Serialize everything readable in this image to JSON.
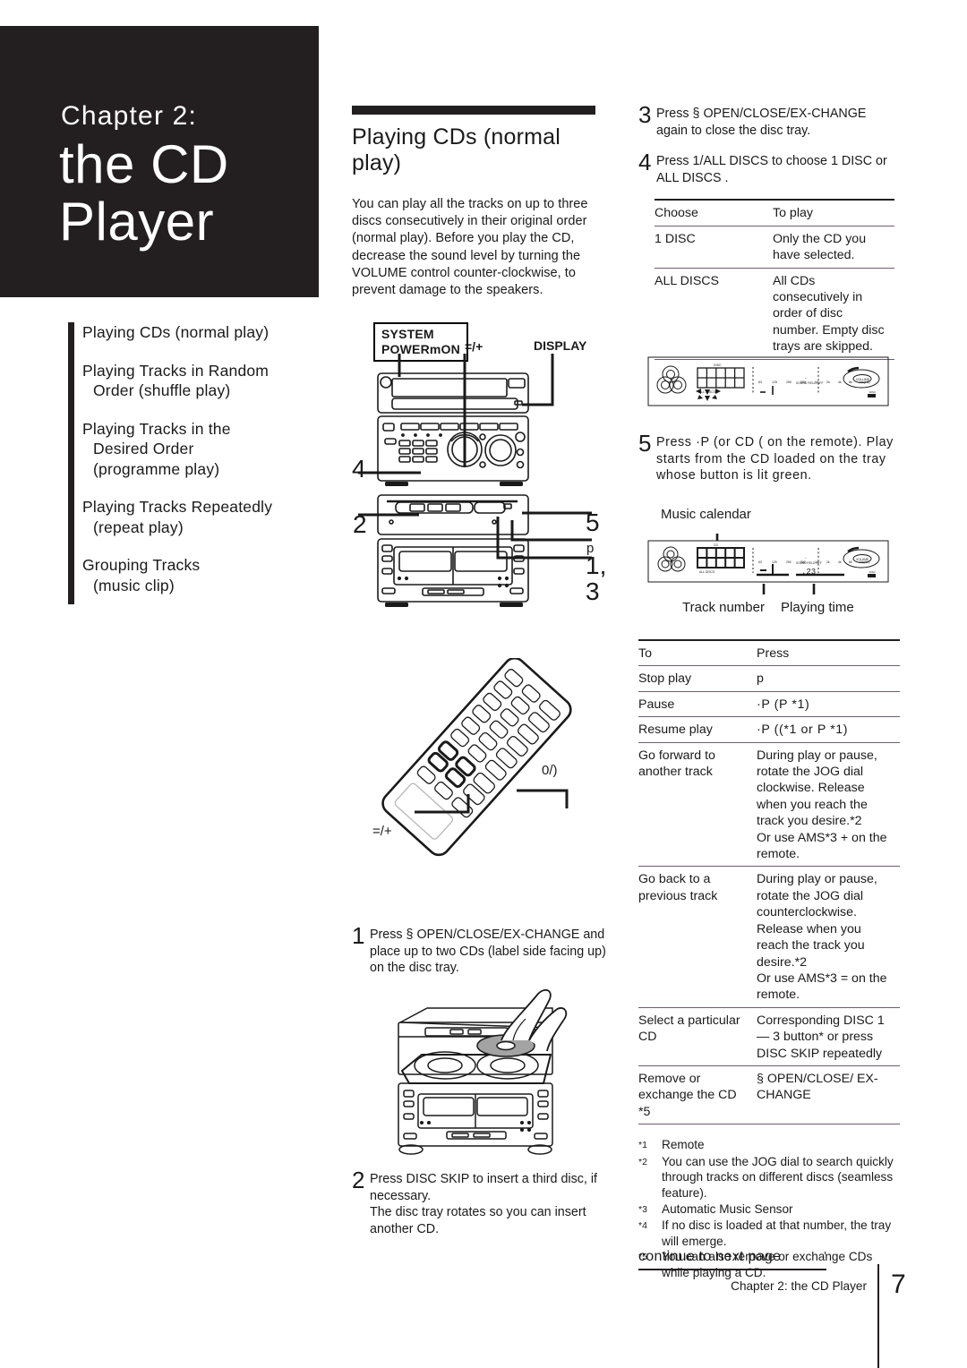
{
  "chapter": {
    "eyebrow": "Chapter 2:",
    "title_line1": "the CD",
    "title_line2": "Player"
  },
  "toc": {
    "items": [
      {
        "line1": "Playing CDs (normal play)",
        "line2": "",
        "line3": ""
      },
      {
        "line1": "Playing Tracks in Random",
        "line2": "Order (shuffle play)",
        "line3": ""
      },
      {
        "line1": "Playing Tracks in the",
        "line2": "Desired Order",
        "line3": "(programme play)"
      },
      {
        "line1": "Playing Tracks Repeatedly",
        "line2": "(repeat play)",
        "line3": ""
      },
      {
        "line1": "Grouping Tracks",
        "line2": "(music clip)",
        "line3": ""
      }
    ]
  },
  "section": {
    "title": "Playing CDs (normal play)",
    "intro": "You can play all the tracks on up to three discs consecutively in their original order (normal play). Before you play the CD, decrease the sound level by turning the VOLUME control counter-clockwise, to prevent damage to the speakers."
  },
  "unit_diagram": {
    "system_power_line1": "SYSTEM",
    "system_power_line2": "POWERmON",
    "label_skip": "=/+",
    "label_display": "DISPLAY",
    "callout_4": "4",
    "callout_2": "2",
    "callout_5": "5",
    "callout_p": "p",
    "callout_1_3_a": "1,",
    "callout_1_3_b": "3"
  },
  "remote_diagram": {
    "label_left": "=/+",
    "label_right": "0/)"
  },
  "steps_mid": [
    {
      "num": "1",
      "text": "Press § OPEN/CLOSE/EX-CHANGE and place up to two CDs (label side facing up) on the disc tray."
    },
    {
      "num": "2",
      "text": "Press DISC SKIP to insert a third disc, if necessary.\nThe disc tray rotates so you can insert another CD."
    }
  ],
  "steps_right": [
    {
      "num": "3",
      "text": "Press § OPEN/CLOSE/EX-CHANGE again to close the disc tray."
    },
    {
      "num": "4",
      "text": "Press 1/ALL DISCS to choose 1 DISC or  ALL DISCS ."
    },
    {
      "num": "5",
      "text": "Press ·P (or CD ( on the remote). Play starts from the CD loaded on the tray whose button is lit green."
    }
  ],
  "choose_table": {
    "headers": [
      "Choose",
      "To play"
    ],
    "rows": [
      [
        "1 DISC",
        "Only the CD you have selected."
      ],
      [
        "ALL DISCS",
        "All CDs consecutively in order of disc number. Empty disc trays are skipped."
      ]
    ]
  },
  "display_diagram": {
    "label_music_calendar": "Music calendar",
    "label_track_number": "Track number",
    "label_playing_time": "Playing time",
    "panel_all_discs": "ALL DISCS",
    "panel_cd": "CD",
    "panel_time": ".23",
    "panel_dash": "-",
    "panel_eq_ticks": [
      "63",
      "125",
      "250",
      "500",
      "1k",
      "2k",
      "4k",
      "8k",
      "16k(Hz)"
    ],
    "panel_sound_field": "SOUND FIELD OFF",
    "panel_volume": "VOLUME",
    "panel_disc": "DISC",
    "panel_calendar_numbers": [
      "1",
      "2",
      "3",
      "4",
      "5",
      "6",
      "7",
      "8"
    ]
  },
  "action_table": {
    "headers": [
      "To",
      "Press"
    ],
    "rows": [
      {
        "to": "Stop play",
        "press": "p"
      },
      {
        "to": "Pause",
        "press": "·P   (P *1)"
      },
      {
        "to": "Resume play",
        "press": "·P  ((*1  or   P *1)"
      },
      {
        "to": "Go forward to another track",
        "press": "During play or pause, rotate the JOG dial clockwise. Release when you reach the track you desire.*2\nOr use  AMS*3 + on the remote."
      },
      {
        "to": "Go back to a previous track",
        "press": "During play or pause, rotate the JOG dial counterclockwise. Release when you reach the track you desire.*2\nOr use  AMS*3 = on the remote."
      },
      {
        "to": "Select a particular CD",
        "press": "Corresponding DISC 1 — 3 button* or press DISC SKIP repeatedly"
      },
      {
        "to": "Remove or exchange the CD *5",
        "press": "§ OPEN/CLOSE/ EX-CHANGE"
      }
    ]
  },
  "footnotes": [
    {
      "mark": "*1",
      "text": "Remote"
    },
    {
      "mark": "*2",
      "text": "You can use the JOG dial to search quickly through tracks on different discs (seamless feature)."
    },
    {
      "mark": "*3",
      "text": "Automatic Music Sensor"
    },
    {
      "mark": "*4",
      "text": "If no disc is loaded at that number, the tray will emerge."
    },
    {
      "mark": "*5",
      "text": "You can also remove or exchange CDs while playing a CD."
    }
  ],
  "footer": {
    "continue": "continue to next page",
    "continue_arrow": "′",
    "chapter_footer": "Chapter 2: the CD Player",
    "page_number": "7"
  }
}
